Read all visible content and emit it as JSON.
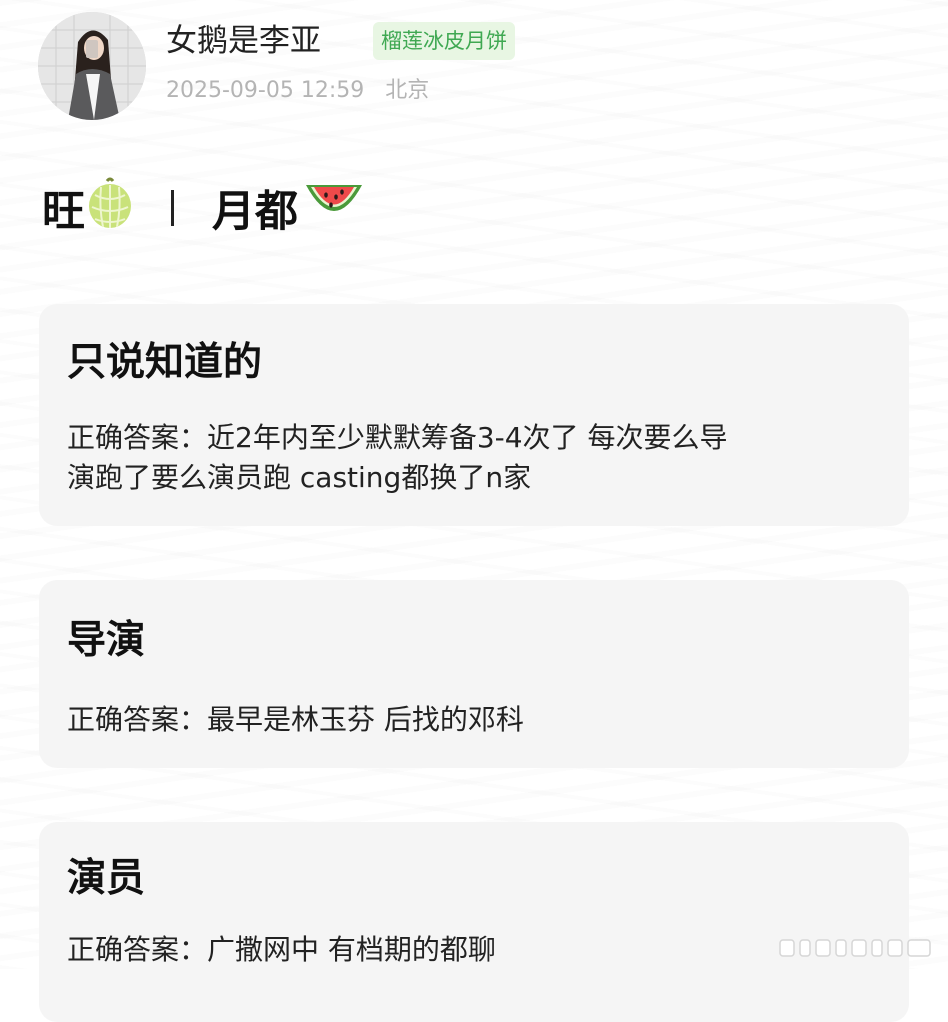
{
  "author": {
    "name": "女鹅是李亚",
    "badge": "榴莲冰皮月饼",
    "timestamp": "2025-09-05 12:59",
    "location": "北京",
    "avatar_icon": "avatar-photo"
  },
  "headline": {
    "part1": "旺",
    "part2": "月都",
    "icons": [
      "melon-icon",
      "watermelon-icon"
    ]
  },
  "cards": [
    {
      "title": "只说知道的",
      "lines": [
        "正确答案：近2年内至少默默筹备3-4次了 每次要么导",
        "演跑了要么演员跑 casting都换了n家"
      ]
    },
    {
      "title": "导演",
      "lines": [
        "正确答案：最早是林玉芬 后找的邓科"
      ]
    },
    {
      "title": "演员",
      "lines": [
        "正确答案：广撒网中 有档期的都聊"
      ]
    }
  ],
  "colors": {
    "badge_bg": "#e8f6e3",
    "badge_text": "#3fa852",
    "meta_text": "#b4b4b4",
    "card_bg": "#f5f5f5"
  }
}
